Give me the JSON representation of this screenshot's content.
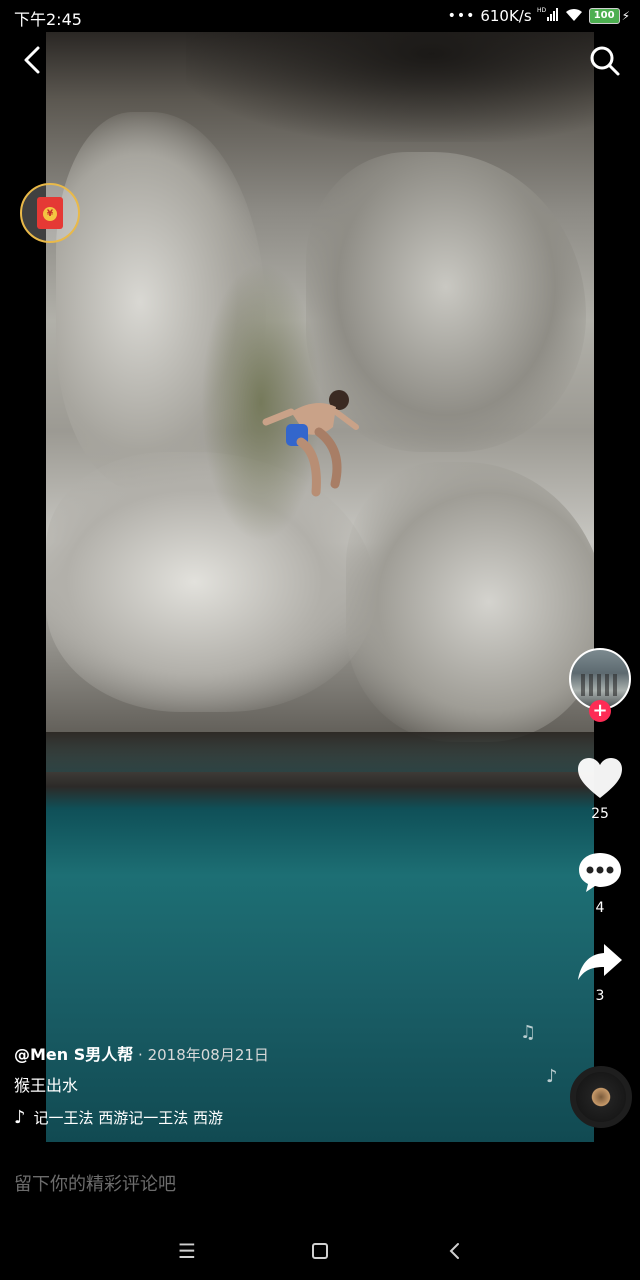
{
  "status_bar": {
    "time": "下午2:45",
    "dots": "•••",
    "network_speed": "610K/s",
    "signal": "HD",
    "battery": "100",
    "battery_color": "#4caf50"
  },
  "video": {
    "like_count": "25",
    "comment_count": "4",
    "share_count": "3"
  },
  "caption": {
    "author": "@Men S男人帮",
    "date": " · 2018年08月21日",
    "description": "猴王出水",
    "music": "记一王法   西游记一王法   西游"
  },
  "comment_input": {
    "placeholder": "留下你的精彩评论吧"
  },
  "colors": {
    "follow_badge": "#fe2c55",
    "red_packet_ring": "#e9b949"
  },
  "icons": {
    "back": "chevron-left-icon",
    "search": "search-icon",
    "like": "heart-icon",
    "comment": "comment-icon",
    "share": "share-icon",
    "music": "tiktok-note-icon"
  }
}
